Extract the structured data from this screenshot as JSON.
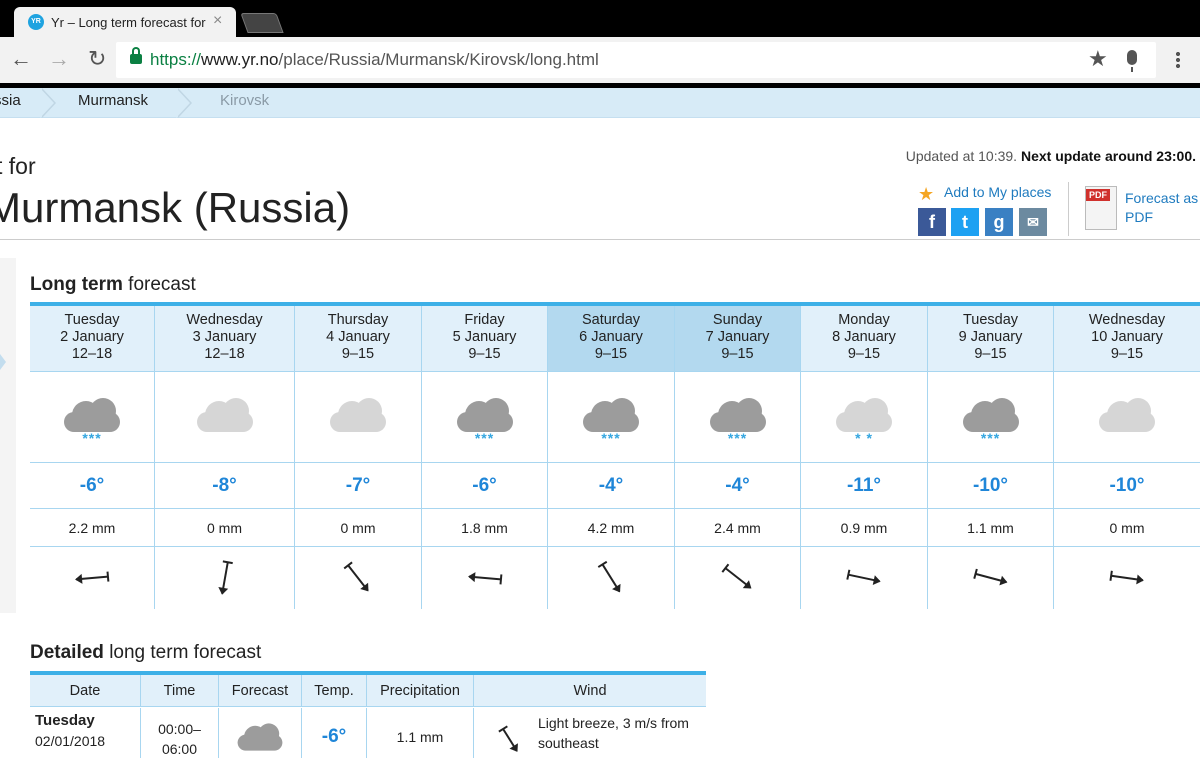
{
  "browser": {
    "tab_title": "Yr – Long term forecast for",
    "favicon_text": "YR",
    "url_scheme": "https://",
    "url_host": "www.yr.no",
    "url_path": "/place/Russia/Murmansk/Kirovsk/long.html"
  },
  "breadcrumb": [
    "ssia",
    "Murmansk",
    "Kirovsk"
  ],
  "header": {
    "subtitle": "t for",
    "title": "Murmansk (Russia)",
    "updated_prefix": "Updated at 10:39.",
    "next_update": "Next update around 23:00.",
    "add_places": "Add to My places",
    "pdf_line1": "Forecast as",
    "pdf_line2": "PDF",
    "pdf_badge": "PDF"
  },
  "long_term": {
    "title_bold": "Long term",
    "title_rest": " forecast",
    "days": [
      {
        "weekday": "Tuesday",
        "date": "2 January",
        "hours": "12–18",
        "icon": "dark-cloud-snow",
        "temp": "-6°",
        "precip": "2.2 mm",
        "wind_deg": 175
      },
      {
        "weekday": "Wednesday",
        "date": "3 January",
        "hours": "12–18",
        "icon": "light-cloud",
        "temp": "-8°",
        "precip": "0 mm",
        "wind_deg": 100
      },
      {
        "weekday": "Thursday",
        "date": "4 January",
        "hours": "9–15",
        "icon": "light-cloud",
        "temp": "-7°",
        "precip": "0 mm",
        "wind_deg": 52
      },
      {
        "weekday": "Friday",
        "date": "5 January",
        "hours": "9–15",
        "icon": "dark-cloud-snow",
        "temp": "-6°",
        "precip": "1.8 mm",
        "wind_deg": 185
      },
      {
        "weekday": "Saturday",
        "date": "6 January",
        "hours": "9–15",
        "icon": "dark-cloud-snow",
        "temp": "-4°",
        "precip": "4.2 mm",
        "wind_deg": 58,
        "selected": true
      },
      {
        "weekday": "Sunday",
        "date": "7 January",
        "hours": "9–15",
        "icon": "dark-cloud-snow",
        "temp": "-4°",
        "precip": "2.4 mm",
        "wind_deg": 38,
        "selected": true
      },
      {
        "weekday": "Monday",
        "date": "8 January",
        "hours": "9–15",
        "icon": "light-cloud-snow",
        "temp": "-11°",
        "precip": "0.9 mm",
        "wind_deg": 12
      },
      {
        "weekday": "Tuesday",
        "date": "9 January",
        "hours": "9–15",
        "icon": "dark-cloud-snow",
        "temp": "-10°",
        "precip": "1.1 mm",
        "wind_deg": 15
      },
      {
        "weekday": "Wednesday",
        "date": "10 January",
        "hours": "9–15",
        "icon": "light-cloud",
        "temp": "-10°",
        "precip": "0 mm",
        "wind_deg": 8
      }
    ]
  },
  "detailed": {
    "title_bold": "Detailed",
    "title_rest": " long term forecast",
    "headers": [
      "Date",
      "Time",
      "Forecast",
      "Temp.",
      "Precipitation",
      "Wind"
    ],
    "row": {
      "day": "Tuesday",
      "date": "02/01/2018",
      "time1": "00:00–",
      "time2": "06:00",
      "temp": "-6°",
      "precip": "1.1 mm",
      "wind1": "Light breeze, 3 m/s from",
      "wind2": "southeast"
    }
  }
}
